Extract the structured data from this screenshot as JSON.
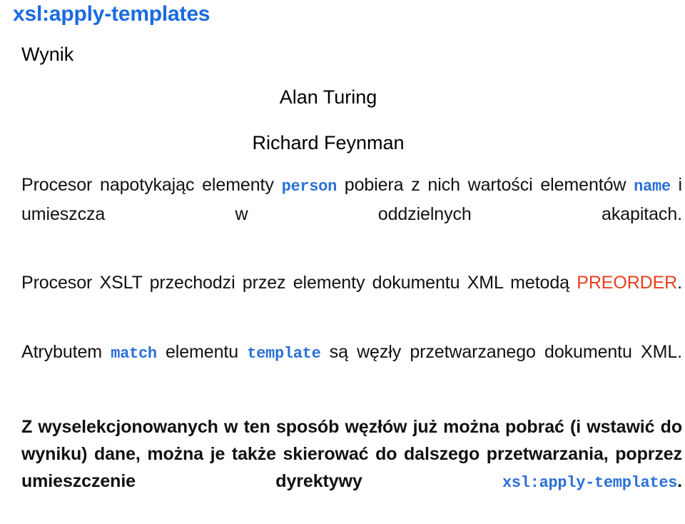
{
  "slide": {
    "title": "xsl:apply-templates",
    "colors": {
      "title_blue": "#1a6ae0",
      "code_blue": "#2b6fd8",
      "preorder_orange": "#e8401f",
      "text_black": "#111111",
      "background": "#ffffff"
    },
    "result": {
      "label": "Wynik",
      "names": [
        "Alan Turing",
        "Richard Feynman"
      ]
    },
    "paragraphs": [
      {
        "id": "p1",
        "parts": [
          {
            "type": "text",
            "value": "Procesor napotykając elementy "
          },
          {
            "type": "code",
            "value": "person"
          },
          {
            "type": "text",
            "value": " pobiera z nich wartości elementów "
          },
          {
            "type": "code",
            "value": "name"
          },
          {
            "type": "text",
            "value": " i umieszcza w oddzielnych akapitach."
          }
        ],
        "plain": "Procesor napotykając elementy person pobiera z nich wartości elementów name i umieszcza w oddzielnych akapitach."
      },
      {
        "id": "p2",
        "parts": [
          {
            "type": "text",
            "value": "Procesor XSLT przechodzi przez elementy dokumentu XML metodą "
          },
          {
            "type": "keyword",
            "value": "PREORDER"
          },
          {
            "type": "text",
            "value": "."
          }
        ],
        "plain": "Procesor XSLT przechodzi przez elementy dokumentu XML metodą PREORDER."
      },
      {
        "id": "p3",
        "parts": [
          {
            "type": "text",
            "value": "Atrybutem "
          },
          {
            "type": "code",
            "value": "match"
          },
          {
            "type": "text",
            "value": " elementu "
          },
          {
            "type": "code",
            "value": "template"
          },
          {
            "type": "text",
            "value": " są węzły przetwarzanego dokumentu XML."
          }
        ],
        "plain": "Atrybutem match elementu template są węzły przetwarzanego dokumentu XML."
      },
      {
        "id": "p4",
        "parts": [
          {
            "type": "text",
            "value": "Z wyselekcjonowanych w ten sposób węzłów już można pobrać (i wstawić do wyniku) dane, można je także skierować do dalszego przetwarzania, poprzez umieszczenie dyrektywy "
          },
          {
            "type": "code",
            "value": "xsl:apply-templates"
          },
          {
            "type": "text",
            "value": "."
          }
        ],
        "plain": "Z wyselekcjonowanych w ten sposób węzłów już można pobrać (i wstawić do wyniku) dane, można je także skierować do dalszego przetwarzania, poprzez umieszczenie dyrektywy xsl:apply-templates."
      }
    ],
    "fragments": {
      "p1_t1": "Procesor napotykając elementy ",
      "p1_c1": "person",
      "p1_t2": " pobiera z nich wartości elementów ",
      "p1_c2": "name",
      "p1_t3": " i umieszcza w oddzielnych akapitach.",
      "p2_t1": "Procesor XSLT przechodzi przez elementy dokumentu XML metodą ",
      "p2_k1": "PREORDER",
      "p2_t2": ".",
      "p3_t1": "Atrybutem ",
      "p3_c1": "match",
      "p3_t2": " elementu ",
      "p3_c2": "template",
      "p3_t3": " są węzły przetwarzanego dokumentu XML.",
      "p4_t1": "Z wyselekcjonowanych w ten sposób węzłów już można pobrać (i wstawić do wyniku) dane, można je także skierować do dalszego przetwarzania, poprzez umieszczenie dyrektywy ",
      "p4_c1": "xsl:apply-templates",
      "p4_t2": "."
    }
  }
}
